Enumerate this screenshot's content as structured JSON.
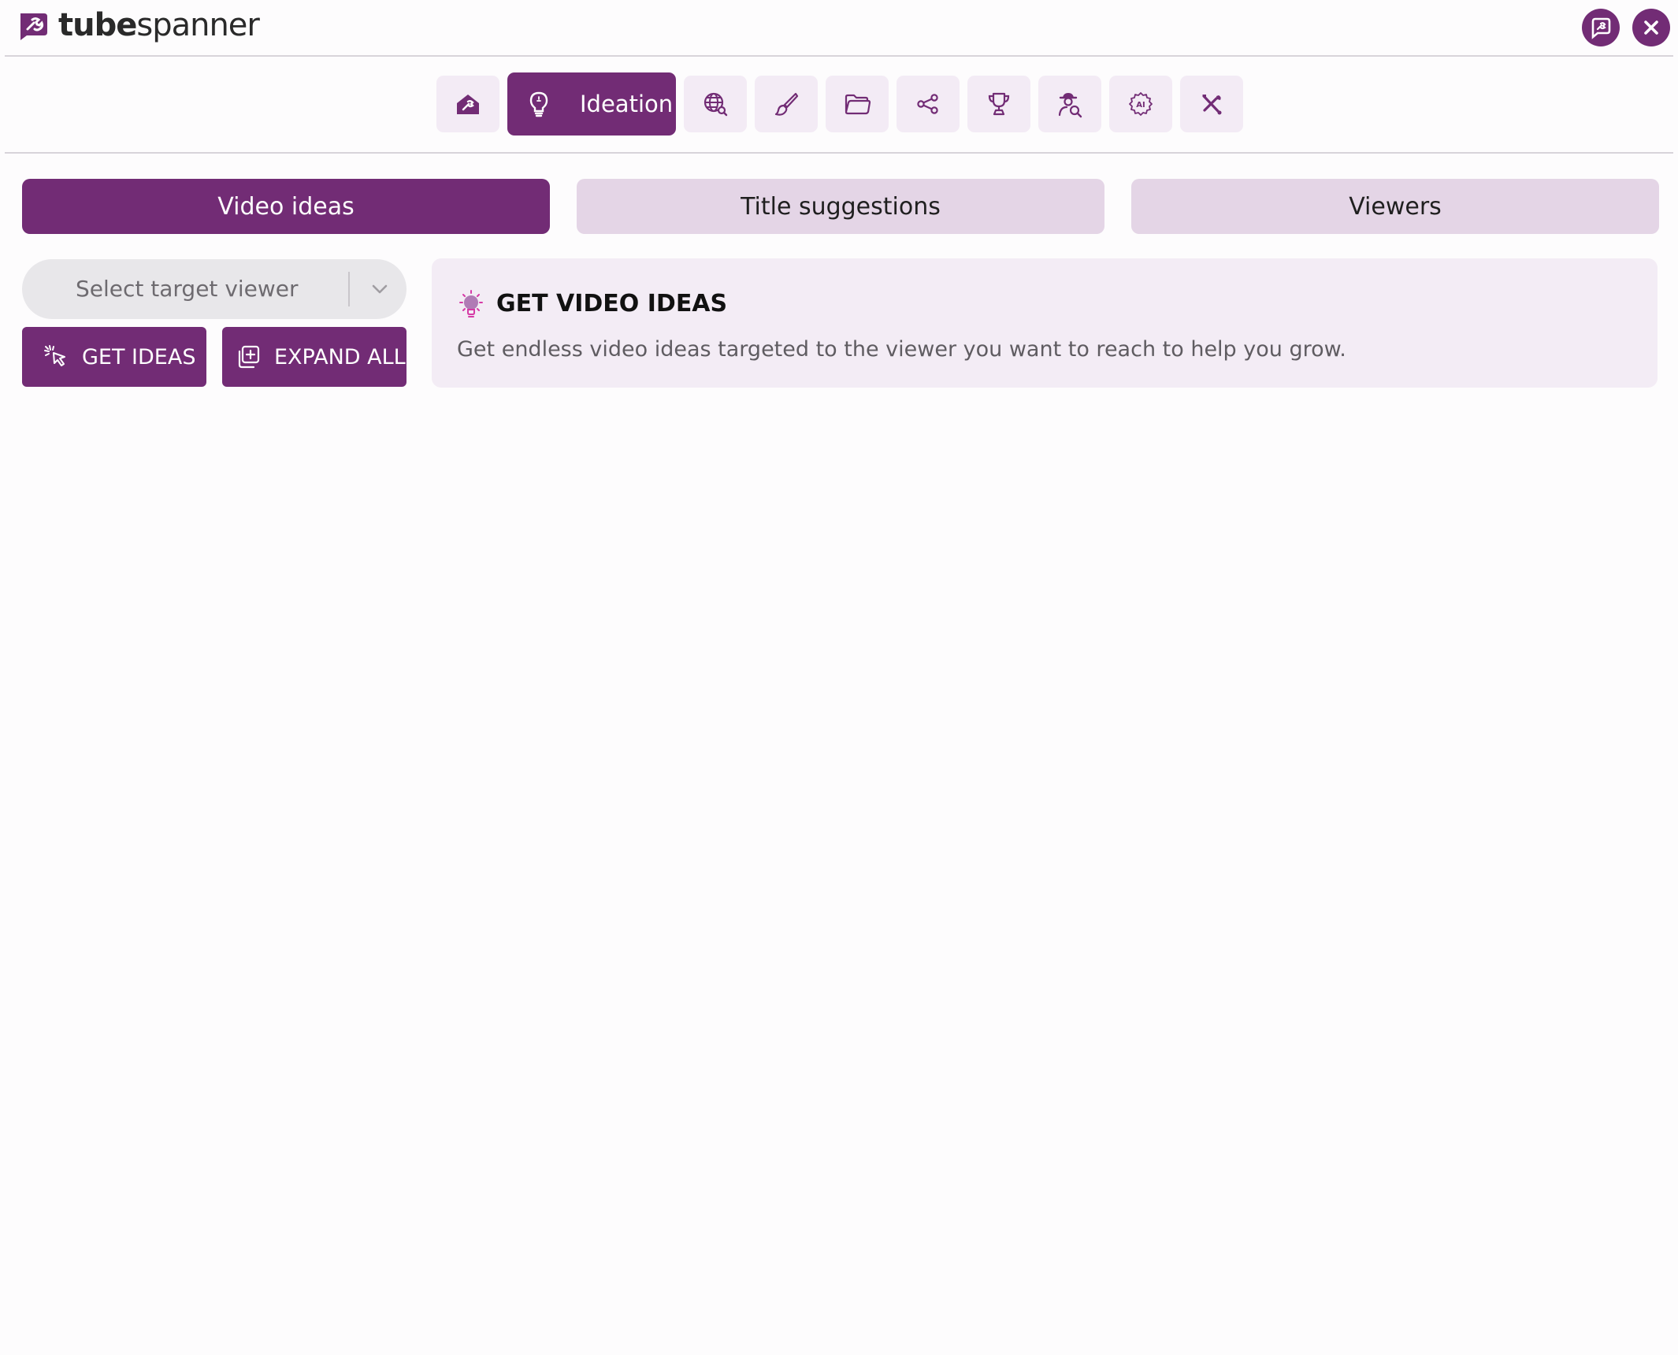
{
  "app": {
    "logo_bold": "tube",
    "logo_regular": "spanner",
    "brand_color": "#722c75",
    "header_buttons": [
      {
        "icon": "chat-logo-icon"
      },
      {
        "icon": "close-icon"
      }
    ]
  },
  "toolbar": {
    "items": [
      {
        "icon": "home-icon"
      },
      {
        "icon": "lightbulb-icon",
        "label": "Ideation",
        "active": true
      },
      {
        "icon": "globe-search-icon"
      },
      {
        "icon": "brush-icon"
      },
      {
        "icon": "folder-icon"
      },
      {
        "icon": "share-icon"
      },
      {
        "icon": "trophy-icon"
      },
      {
        "icon": "spy-search-icon"
      },
      {
        "icon": "ai-chip-icon"
      },
      {
        "icon": "tools-icon"
      }
    ]
  },
  "subtabs": [
    {
      "label": "Video ideas",
      "active": true
    },
    {
      "label": "Title suggestions",
      "active": false
    },
    {
      "label": "Viewers",
      "active": false
    }
  ],
  "controls": {
    "select_placeholder": "Select target viewer",
    "get_ideas_label": "GET IDEAS",
    "expand_all_label": "EXPAND ALL"
  },
  "info": {
    "title": "GET VIDEO IDEAS",
    "description": "Get endless video ideas targeted to the viewer you want to reach to help you grow."
  }
}
